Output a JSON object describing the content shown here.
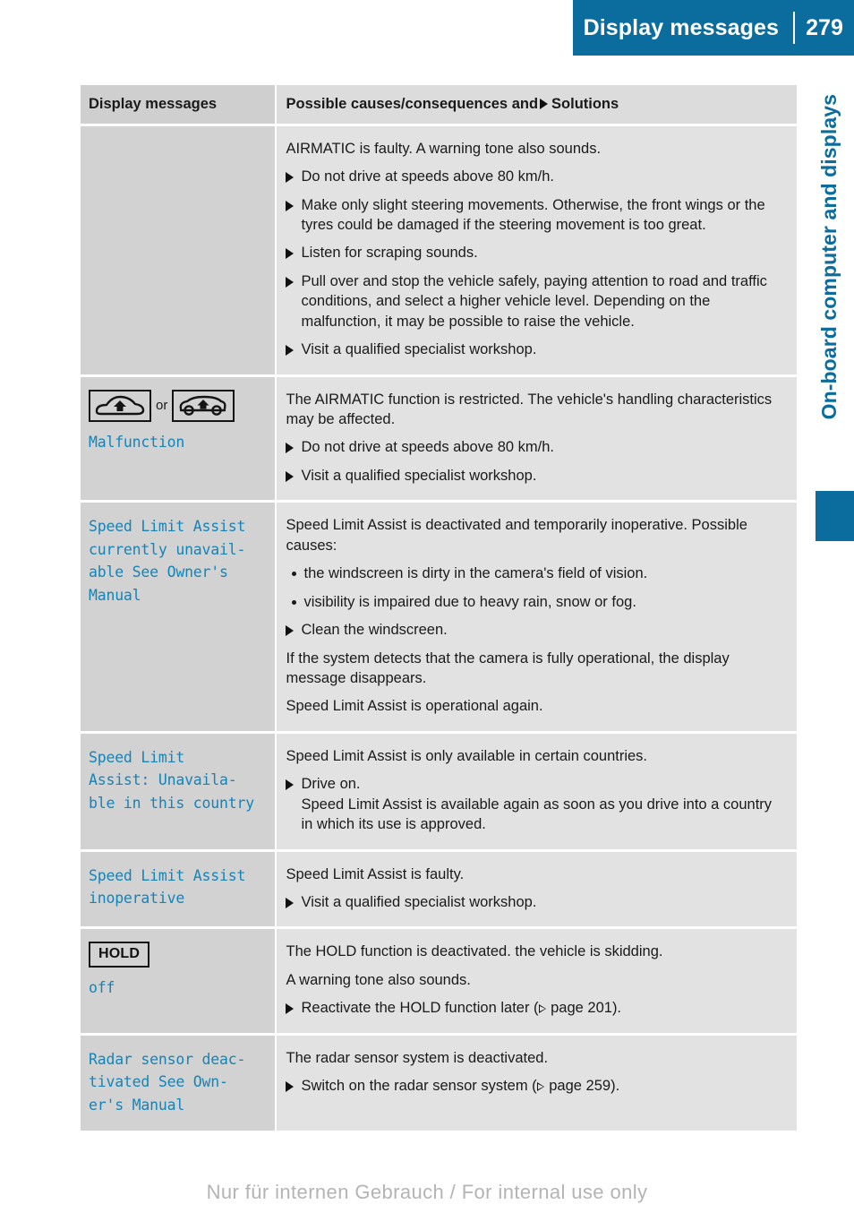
{
  "header": {
    "title": "Display messages",
    "page_number": "279"
  },
  "chapter_tab": {
    "label": "On-board computer and displays",
    "accent_color": "#0a6d9e"
  },
  "table": {
    "columns": {
      "left": "Display messages",
      "right_prefix": "Possible causes/consequences and",
      "right_suffix": "Solutions"
    },
    "rows": [
      {
        "left": {
          "icons": [],
          "message": ""
        },
        "right": {
          "blocks": [
            {
              "type": "text",
              "text": "AIRMATIC is faulty. A warning tone also sounds."
            },
            {
              "type": "action",
              "text": "Do not drive at speeds above 80 km/h."
            },
            {
              "type": "action",
              "text": "Make only slight steering movements. Otherwise, the front wings or the tyres could be damaged if the steering movement is too great."
            },
            {
              "type": "action",
              "text": "Listen for scraping sounds."
            },
            {
              "type": "action",
              "text": "Pull over and stop the vehicle safely, paying attention to road and traffic conditions, and select a higher vehicle level. Depending on the malfunction, it may be possible to raise the vehicle."
            },
            {
              "type": "action",
              "text": "Visit a qualified specialist workshop."
            }
          ]
        }
      },
      {
        "left": {
          "icons": [
            "car-sedan-raise-icon",
            "car-estate-raise-icon"
          ],
          "icon_separator": "or",
          "message": "Malfunction"
        },
        "right": {
          "blocks": [
            {
              "type": "text",
              "text": "The AIRMATIC function is restricted. The vehicle's handling characteristics may be affected."
            },
            {
              "type": "action",
              "text": "Do not drive at speeds above 80 km/h."
            },
            {
              "type": "action",
              "text": "Visit a qualified specialist workshop."
            }
          ]
        }
      },
      {
        "left": {
          "icons": [],
          "message": "Speed Limit Assist\ncurrently unavail-\nable See Owner's\nManual"
        },
        "right": {
          "blocks": [
            {
              "type": "text",
              "text": "Speed Limit Assist is deactivated and temporarily inoperative. Possible causes:"
            },
            {
              "type": "dot",
              "text": "the windscreen is dirty in the camera's field of vision."
            },
            {
              "type": "dot",
              "text": "visibility is impaired due to heavy rain, snow or fog."
            },
            {
              "type": "action",
              "text": "Clean the windscreen."
            },
            {
              "type": "text",
              "text": "If the system detects that the camera is fully operational, the display message disappears."
            },
            {
              "type": "text",
              "text": "Speed Limit Assist is operational again."
            }
          ]
        }
      },
      {
        "left": {
          "icons": [],
          "message": "Speed Limit\nAssist: Unavaila-\nble in this country"
        },
        "right": {
          "blocks": [
            {
              "type": "text",
              "text": "Speed Limit Assist is only available in certain countries."
            },
            {
              "type": "action",
              "text": "Drive on.",
              "sub": "Speed Limit Assist is available again as soon as you drive into a country in which its use is approved."
            }
          ]
        }
      },
      {
        "left": {
          "icons": [],
          "message": "Speed Limit Assist\ninoperative"
        },
        "right": {
          "blocks": [
            {
              "type": "text",
              "text": "Speed Limit Assist is faulty."
            },
            {
              "type": "action",
              "text": "Visit a qualified specialist workshop."
            }
          ]
        }
      },
      {
        "left": {
          "icons": [
            "hold-badge-icon"
          ],
          "badge_label": "HOLD",
          "message": "off"
        },
        "right": {
          "blocks": [
            {
              "type": "text",
              "text": "The HOLD function is deactivated. the vehicle is skidding."
            },
            {
              "type": "text",
              "text": "A warning tone also sounds."
            },
            {
              "type": "action_ref",
              "text": "Reactivate the HOLD function later (",
              "ref": " page 201",
              "tail": ")."
            }
          ]
        }
      },
      {
        "left": {
          "icons": [],
          "message": "Radar sensor deac-\ntivated See Own-\ner's Manual"
        },
        "right": {
          "blocks": [
            {
              "type": "text",
              "text": "The radar sensor system is deactivated."
            },
            {
              "type": "action_ref",
              "text": "Switch on the radar sensor system (",
              "ref": " page 259",
              "tail": ")."
            }
          ]
        }
      }
    ]
  },
  "footer": {
    "watermark": "Nur für internen Gebrauch / For internal use only"
  }
}
